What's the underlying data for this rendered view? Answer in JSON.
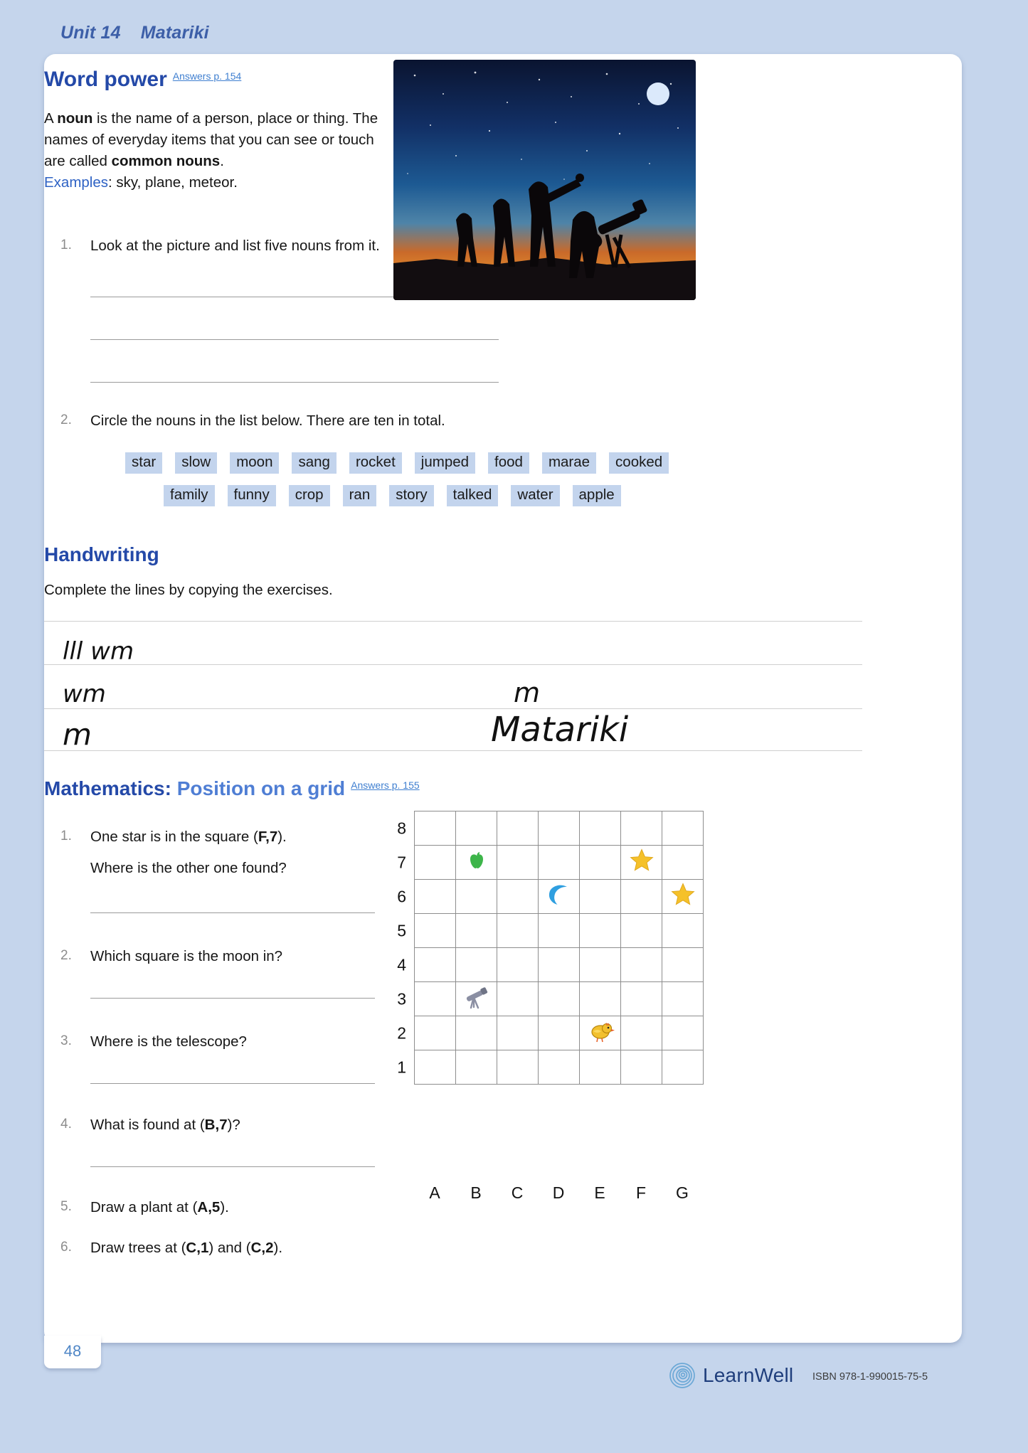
{
  "running_head": {
    "unit": "Unit 14",
    "topic": "Matariki"
  },
  "sections": {
    "word_power": {
      "title": "Word power",
      "answers_ref": "Answers p. 154",
      "intro": {
        "line1_a": "A ",
        "line1_b": "noun",
        "line1_c": " is the name of a person, place or thing.",
        "line2_a": "The names of everyday items that you can see or touch are called ",
        "line2_b": "common nouns",
        "line2_c": ".",
        "examples_label": "Examples",
        "examples_text": ": sky, plane, meteor."
      },
      "q1": {
        "num": "1.",
        "text": "Look at the picture and list five nouns from it."
      },
      "q2": {
        "num": "2.",
        "text": "Circle the nouns in the list below. There are ten in total."
      },
      "word_bank_row1": [
        "star",
        "slow",
        "moon",
        "sang",
        "rocket",
        "jumped",
        "food",
        "marae",
        "cooked"
      ],
      "word_bank_row2": [
        "family",
        "funny",
        "crop",
        "ran",
        "story",
        "talked",
        "water",
        "apple"
      ],
      "photo_alt": "stargazers-telescope-photo"
    },
    "handwriting": {
      "title": "Handwriting",
      "instruction": "Complete the lines by copying the exercises.",
      "row1_left": "lll wm",
      "row2_left": "wm",
      "row2_right": "m",
      "row3_left": "m",
      "row3_right": "Matariki"
    },
    "mathematics": {
      "title_bold": "Mathematics:",
      "title_light": "Position on a grid",
      "answers_ref": "Answers p. 155",
      "questions": [
        {
          "num": "1.",
          "pre": "One star is in the square (",
          "coord_a": "F",
          "comma": ",",
          "coord_b": "7",
          "post": ").",
          "line2": "Where is the other one found?",
          "has_line": true
        },
        {
          "num": "2.",
          "pre": "Which square is the moon in?",
          "coord_a": "",
          "comma": "",
          "coord_b": "",
          "post": "",
          "line2": "",
          "has_line": true
        },
        {
          "num": "3.",
          "pre": "Where is the telescope?",
          "coord_a": "",
          "comma": "",
          "coord_b": "",
          "post": "",
          "line2": "",
          "has_line": true
        },
        {
          "num": "4.",
          "pre": "What is found at (",
          "coord_a": "B",
          "comma": ",",
          "coord_b": "7",
          "post": ")?",
          "line2": "",
          "has_line": true
        },
        {
          "num": "5.",
          "pre": "Draw a plant at (",
          "coord_a": "A",
          "comma": ",",
          "coord_b": "5",
          "post": ").",
          "line2": "",
          "has_line": false
        },
        {
          "num": "6.",
          "pre": "Draw trees at (",
          "coord_a": "C",
          "comma": ",",
          "coord_b": "1",
          "post": ") and (",
          "coord_c": "C",
          "comma2": ",",
          "coord_d": "2",
          "post2": ").",
          "line2": "",
          "has_line": false
        }
      ]
    }
  },
  "chart_data": {
    "type": "table",
    "title": "Position on a grid",
    "columns": [
      "A",
      "B",
      "C",
      "D",
      "E",
      "F",
      "G"
    ],
    "rows": [
      "8",
      "7",
      "6",
      "5",
      "4",
      "3",
      "2",
      "1"
    ],
    "xlabel": "",
    "ylabel": "",
    "grid": true,
    "items": [
      {
        "icon": "apple-icon",
        "glyph": "apple",
        "col": "B",
        "row": "7",
        "color": "#3db54a"
      },
      {
        "icon": "star-icon",
        "glyph": "star",
        "col": "F",
        "row": "7",
        "color": "#f5c12a"
      },
      {
        "icon": "moon-icon",
        "glyph": "moon",
        "col": "D",
        "row": "6",
        "color": "#2f9fe0"
      },
      {
        "icon": "star-icon",
        "glyph": "star",
        "col": "G",
        "row": "6",
        "color": "#f5c12a"
      },
      {
        "icon": "telescope-icon",
        "glyph": "telescope",
        "col": "B",
        "row": "3",
        "color": "#8b8fa3"
      },
      {
        "icon": "chick-icon",
        "glyph": "chick",
        "col": "E",
        "row": "2",
        "color": "#f2c02e"
      }
    ]
  },
  "footer": {
    "page_number": "48",
    "brand": "LearnWell",
    "isbn": "ISBN 978-1-990015-75-5"
  }
}
